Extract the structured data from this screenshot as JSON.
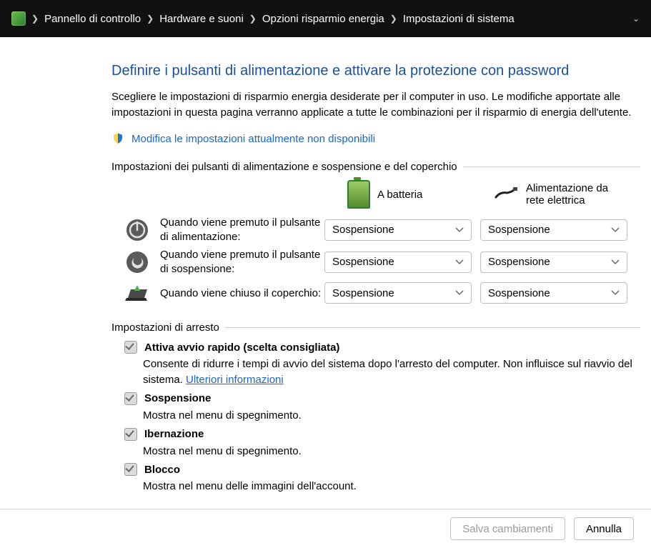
{
  "breadcrumb": {
    "items": [
      "Pannello di controllo",
      "Hardware e suoni",
      "Opzioni risparmio energia",
      "Impostazioni di sistema"
    ]
  },
  "heading": "Definire i pulsanti di alimentazione e attivare la protezione con password",
  "description": "Scegliere le impostazioni di risparmio energia desiderate per il computer in uso. Le modifiche apportate alle impostazioni in questa pagina verranno applicate a tutte le combinazioni per il risparmio di energia dell'utente.",
  "admin_link": "Modifica le impostazioni attualmente non disponibili",
  "group1_legend": "Impostazioni dei pulsanti di alimentazione e sospensione e del coperchio",
  "columns": {
    "battery": "A batteria",
    "ac": "Alimentazione da\nrete elettrica"
  },
  "rows": {
    "power_button": {
      "label": "Quando viene premuto il pulsante di alimentazione:",
      "battery_value": "Sospensione",
      "ac_value": "Sospensione"
    },
    "sleep_button": {
      "label": "Quando viene premuto il pulsante di sospensione:",
      "battery_value": "Sospensione",
      "ac_value": "Sospensione"
    },
    "lid_close": {
      "label": "Quando viene chiuso il coperchio:",
      "battery_value": "Sospensione",
      "ac_value": "Sospensione"
    }
  },
  "group2_legend": "Impostazioni di arresto",
  "shutdown": {
    "fast_startup": {
      "title": "Attiva avvio rapido (scelta consigliata)",
      "desc_a": "Consente di ridurre i tempi di avvio del sistema dopo l'arresto del computer. Non influisce sul riavvio del sistema. ",
      "link": "Ulteriori informazioni"
    },
    "sleep": {
      "title": "Sospensione",
      "desc": "Mostra nel menu di spegnimento."
    },
    "hibernate": {
      "title": "Ibernazione",
      "desc": "Mostra nel menu di spegnimento."
    },
    "lock": {
      "title": "Blocco",
      "desc": "Mostra nel menu delle immagini dell'account."
    }
  },
  "footer": {
    "save": "Salva cambiamenti",
    "cancel": "Annulla"
  }
}
